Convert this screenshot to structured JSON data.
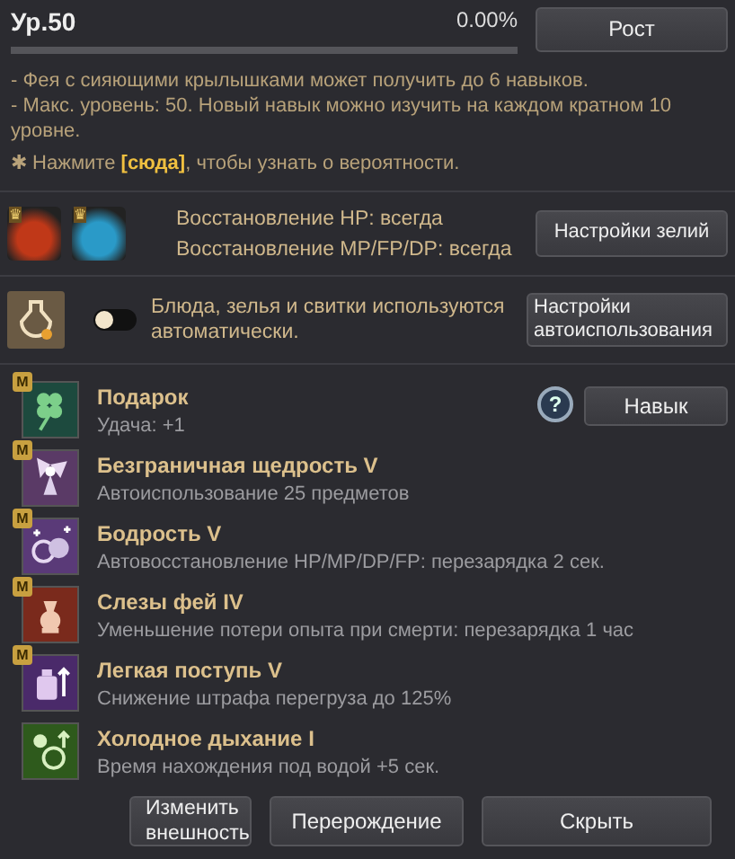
{
  "level": {
    "label": "Ур.50",
    "percent": "0.00%",
    "level": 0.0
  },
  "grow_button": "Рост",
  "notes": [
    "- Фея с сияющими крылышками может получить до 6 навыков.",
    "- Макс. уровень: 50. Новый навык можно изучить на каждом кратном 10 уровне."
  ],
  "hint": {
    "prefix": "✱ Нажмите ",
    "link": "[сюда]",
    "suffix": ", чтобы узнать о вероятности."
  },
  "potions": {
    "badge": "♛",
    "lines": [
      "Восстановление HP: всегда",
      "Восстановление MP/FP/DP: всегда"
    ],
    "button": "Настройки зелий"
  },
  "auto_use": {
    "on": false,
    "text": "Блюда, зелья и свитки используются автоматически.",
    "button": "Настройки автоиспользования"
  },
  "help_button": "?",
  "skill_button": "Навык",
  "skills": [
    {
      "kind": "clover",
      "color": "#1d4a3e",
      "badge": "M",
      "name": "Подарок",
      "desc": "Удача: +1"
    },
    {
      "kind": "fairy",
      "color": "#5a3a66",
      "badge": "M",
      "name": "Безграничная щедрость V",
      "desc": "Автоиспользование 25 предметов"
    },
    {
      "kind": "flasks",
      "color": "#5a3a78",
      "badge": "M",
      "name": "Бодрость V",
      "desc": "Автовосстановление HP/MP/DP/FP: перезарядка 2 сек."
    },
    {
      "kind": "vase",
      "color": "#7a2a1c",
      "badge": "M",
      "name": "Слезы фей IV",
      "desc": "Уменьшение потери опыта при смерти: перезарядка 1 час"
    },
    {
      "kind": "bottle",
      "color": "#4a2a6a",
      "badge": "M",
      "name": "Легкая поступь V",
      "desc": "Снижение штрафа перегруза до 125%"
    },
    {
      "kind": "bubbles",
      "color": "#2e5a1c",
      "name": "Холодное дыхание I",
      "desc": "Время нахождения под водой +5 сек."
    }
  ],
  "footer": [
    "Изменить внешность",
    "Перерождение",
    "Скрыть"
  ]
}
